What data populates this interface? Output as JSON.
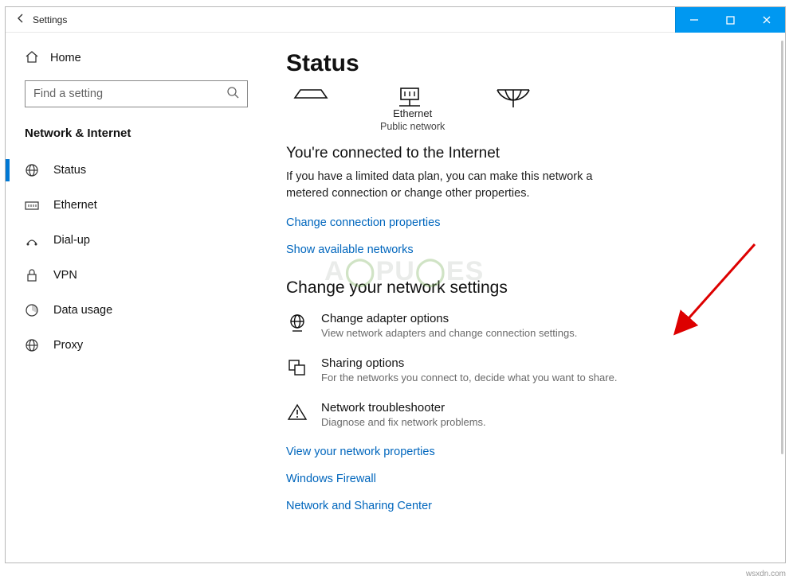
{
  "window": {
    "title": "Settings"
  },
  "sidebar": {
    "home": "Home",
    "search_placeholder": "Find a setting",
    "section": "Network & Internet",
    "items": [
      {
        "label": "Status"
      },
      {
        "label": "Ethernet"
      },
      {
        "label": "Dial-up"
      },
      {
        "label": "VPN"
      },
      {
        "label": "Data usage"
      },
      {
        "label": "Proxy"
      }
    ]
  },
  "main": {
    "title": "Status",
    "net": {
      "eth": "Ethernet",
      "eth_sub": "Public network"
    },
    "connected_head": "You're connected to the Internet",
    "connected_body": "If you have a limited data plan, you can make this network a metered connection or change other properties.",
    "link_change_conn": "Change connection properties",
    "link_show_avail": "Show available networks",
    "change_head": "Change your network settings",
    "options": [
      {
        "title": "Change adapter options",
        "desc": "View network adapters and change connection settings."
      },
      {
        "title": "Sharing options",
        "desc": "For the networks you connect to, decide what you want to share."
      },
      {
        "title": "Network troubleshooter",
        "desc": "Diagnose and fix network problems."
      }
    ],
    "link_view_props": "View your network properties",
    "link_firewall": "Windows Firewall",
    "link_nsc": "Network and Sharing Center"
  },
  "watermark": "A   PU   ES",
  "source": "wsxdn.com"
}
